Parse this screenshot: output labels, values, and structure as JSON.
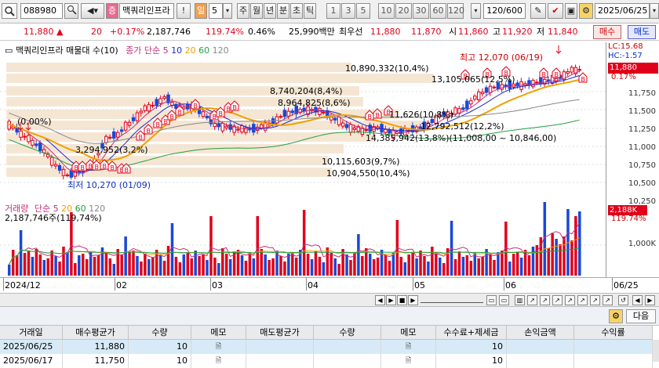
{
  "toolbar": {
    "code": "088980",
    "stock_name": "맥쿼리인프라",
    "sell_marker": "증",
    "timeframe": "일",
    "timeframe_num": "5",
    "periods": [
      "주",
      "월",
      "년",
      "분",
      "초",
      "틱"
    ],
    "minutes": [
      "1",
      "3",
      "5",
      "10",
      "20",
      "30",
      "60",
      "120"
    ],
    "count": "120/600",
    "date": "2025/06/25",
    "excl": "!"
  },
  "quote": {
    "price": "11,880 ▲",
    "change": "20",
    "change_pct": "+0.17%",
    "volume": "2,187,746",
    "vol_ratio": "119.74%",
    "turnover_pct": "0.46%",
    "amount": "25,990백만",
    "best_label": "최우선",
    "best_sell": "11,880",
    "best_buy": "11,870",
    "open_label": "시",
    "open": "11,860",
    "high_label": "고",
    "high": "11,920",
    "low_label": "저",
    "low": "11,840",
    "buy_btn": "매수",
    "sell_btn": "매도"
  },
  "price_legend": {
    "title": "맥쿼리인프라 매물대 수(10)",
    "ma_label": "종가 단순",
    "ma5": "5",
    "ma10": "10",
    "ma20": "20",
    "ma60": "60",
    "ma120": "120"
  },
  "vol_legend": {
    "title": "거래량",
    "ma_label": "단순",
    "ma5": "5",
    "ma20": "20",
    "ma60": "60",
    "ma120": "120",
    "last": "2,187,746주(119,74%)"
  },
  "right_axis": {
    "lc": "LC:15.68",
    "hc": "HC:-1.57",
    "price_box": "11,880",
    "pct": "0.17%",
    "ticks": [
      "11,750",
      "11,500",
      "11,250",
      "11,000",
      "10,750",
      "10,500",
      "10,250"
    ],
    "vol_box": "2,188K",
    "vol_pct": "119.74%",
    "vol_tick": "1,000K"
  },
  "annotations": {
    "high": "최고 12,070 (06/19)",
    "low": "최저 10,270 (01/09)",
    "start_pct": "(0.00%)",
    "vp1": "10,890,332(10,4%)",
    "vp2": "13,105,065(12,5%)",
    "vp3": "8,740,204(8,4%)",
    "vp4": "8,964,825(8,6%)",
    "vp5": "3,294,952(3,2%)",
    "vp6": "11,626(10,8%)",
    "vp7": "12,792,512(12,2%)",
    "vp8": "14,385,942(13,8%)(11,008,00 ~ 10,846,00)",
    "vp9": "10,115,603(9,7%)",
    "vp10": "10,904,550(10,4%)"
  },
  "xaxis": {
    "labels": [
      "2024/12",
      "02",
      "03",
      "04",
      "05",
      "06",
      "06/25"
    ]
  },
  "grid": {
    "next_btn": "다음",
    "headers": [
      "거래일",
      "매수평균가",
      "수량",
      "메모",
      "매도평균가",
      "수량",
      "메모",
      "수수료+제세금",
      "손익금액",
      "수익률"
    ],
    "rows": [
      {
        "date": "2025/06/25",
        "buy_avg": "11,880",
        "qty": "10",
        "fee": "10"
      },
      {
        "date": "2025/06/17",
        "buy_avg": "11,750",
        "qty": "10",
        "fee": "10"
      }
    ]
  },
  "colors": {
    "up": "#e0001a",
    "down": "#1848d8",
    "ma5": "#c0307a",
    "ma10": "#1a2ad0",
    "ma20": "#f0a000",
    "ma60": "#20a040",
    "ma120": "#888888"
  }
}
